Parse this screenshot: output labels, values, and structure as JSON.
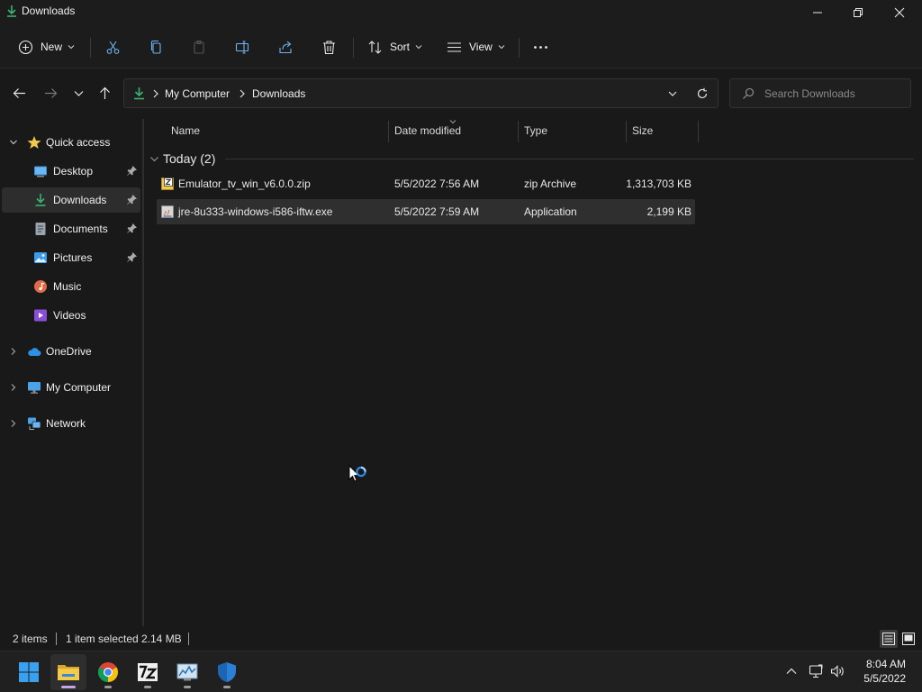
{
  "window": {
    "title": "Downloads"
  },
  "toolbar": {
    "new_label": "New",
    "sort_label": "Sort",
    "view_label": "View"
  },
  "address": {
    "crumbs": [
      "My Computer",
      "Downloads"
    ]
  },
  "search": {
    "placeholder": "Search Downloads"
  },
  "sidebar": {
    "items": [
      {
        "label": "Quick access"
      },
      {
        "label": "Desktop"
      },
      {
        "label": "Downloads"
      },
      {
        "label": "Documents"
      },
      {
        "label": "Pictures"
      },
      {
        "label": "Music"
      },
      {
        "label": "Videos"
      },
      {
        "label": "OneDrive"
      },
      {
        "label": "My Computer"
      },
      {
        "label": "Network"
      }
    ]
  },
  "columns": {
    "name": "Name",
    "date": "Date modified",
    "type": "Type",
    "size": "Size"
  },
  "group": {
    "label": "Today (2)"
  },
  "files": [
    {
      "name": "Emulator_tv_win_v6.0.0.zip",
      "date": "5/5/2022 7:56 AM",
      "type": "zip Archive",
      "size": "1,313,703 KB"
    },
    {
      "name": "jre-8u333-windows-i586-iftw.exe",
      "date": "5/5/2022 7:59 AM",
      "type": "Application",
      "size": "2,199 KB"
    }
  ],
  "status": {
    "items": "2 items",
    "selected": "1 item selected",
    "size": "2.14 MB"
  },
  "clock": {
    "time": "8:04 AM",
    "date": "5/5/2022"
  },
  "colors": {
    "accent": "#0078d4",
    "download_green": "#3cb371",
    "folder_yellow": "#f2c94c"
  }
}
